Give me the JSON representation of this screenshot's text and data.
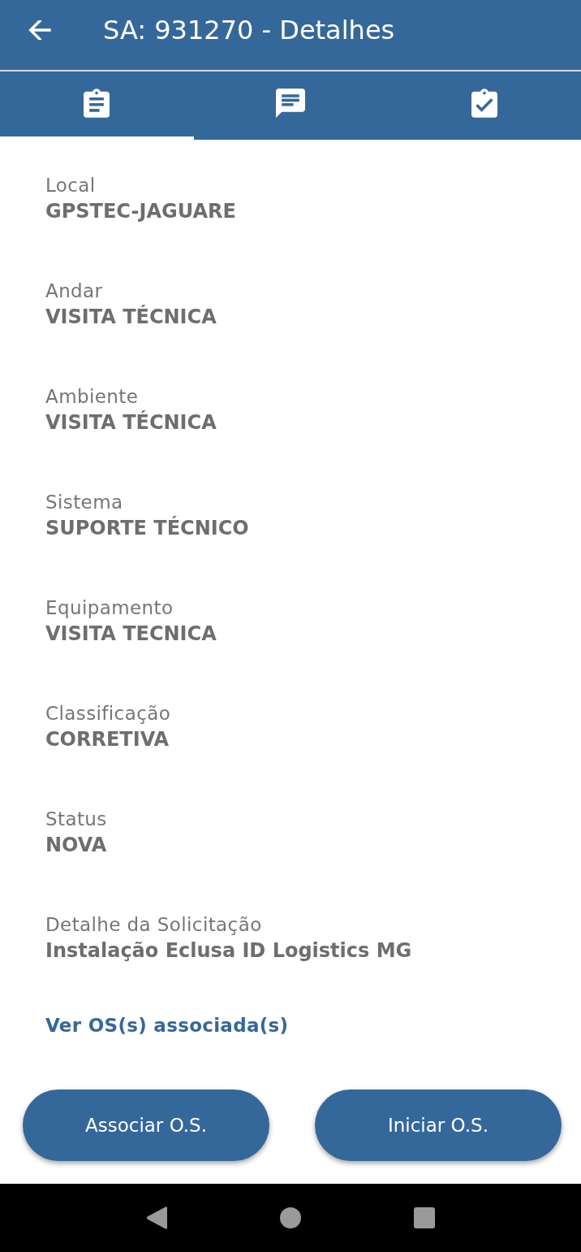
{
  "app_bar": {
    "title": "SA: 931270 - Detalhes"
  },
  "tabs": [
    {
      "selected": true
    },
    {
      "selected": false
    },
    {
      "selected": false
    }
  ],
  "fields": [
    {
      "label": "Local",
      "value": "GPSTEC-JAGUARE"
    },
    {
      "label": "Andar",
      "value": "VISITA TÉCNICA"
    },
    {
      "label": "Ambiente",
      "value": "VISITA TÉCNICA"
    },
    {
      "label": "Sistema",
      "value": "SUPORTE TÉCNICO"
    },
    {
      "label": "Equipamento",
      "value": "VISITA TECNICA"
    },
    {
      "label": "Classificação",
      "value": "CORRETIVA"
    },
    {
      "label": "Status",
      "value": "NOVA"
    },
    {
      "label": "Detalhe da Solicitação",
      "value": "Instalação Eclusa ID Logistics MG"
    }
  ],
  "link": "Ver OS(s) associada(s)",
  "buttons": [
    "Associar O.S.",
    "Iniciar O.S."
  ]
}
